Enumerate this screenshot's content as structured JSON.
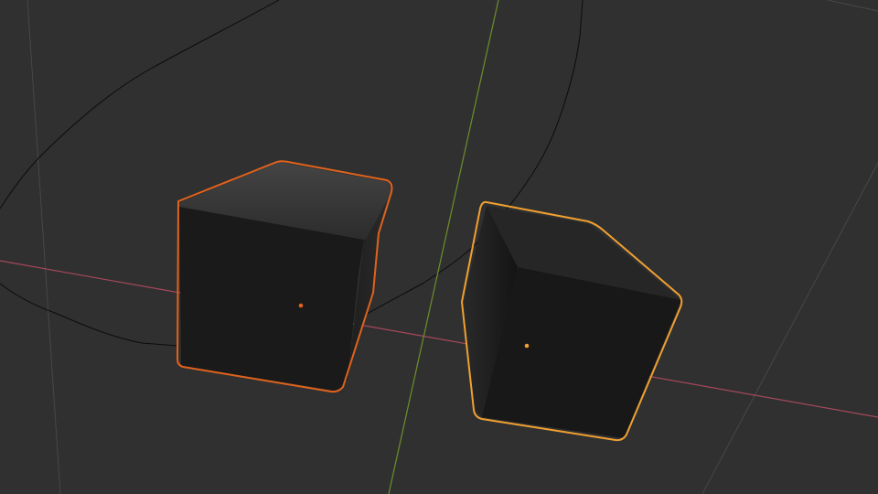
{
  "viewport": {
    "background_color": "#303030",
    "grid_color": "#474747",
    "x_axis_color": "#a5485a",
    "y_axis_color": "#6e8f2a",
    "camera_path_color": "#0c0c0c"
  },
  "objects": [
    {
      "name_id": "cube-1",
      "outline_color": "#e0621c",
      "origin_color": "#e0621c",
      "selected": true,
      "active": false
    },
    {
      "name_id": "cube-2",
      "outline_color": "#f0a030",
      "origin_color": "#f0a030",
      "selected": true,
      "active": true
    }
  ]
}
